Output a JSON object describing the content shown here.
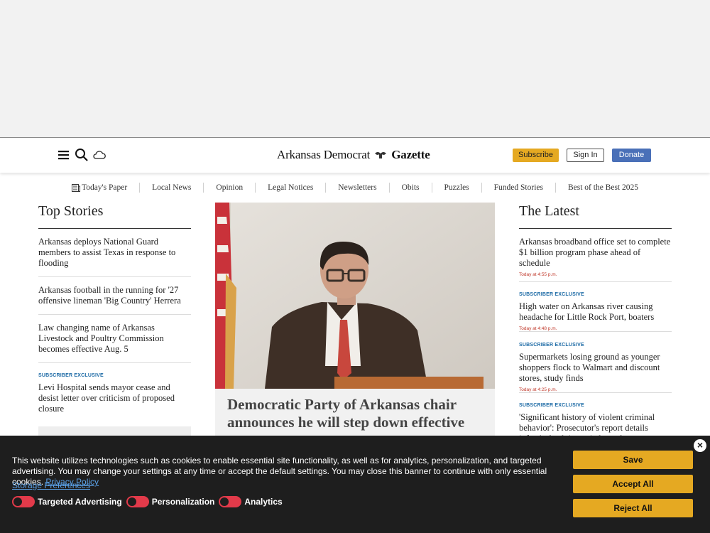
{
  "header": {
    "logo_left": "Arkansas Democrat",
    "logo_right": "Gazette",
    "subscribe_label": "Subscribe",
    "sign_in_label": "Sign In",
    "donate_label": "Donate"
  },
  "nav": {
    "items": [
      "Today's Paper",
      "Local News",
      "Opinion",
      "Legal Notices",
      "Newsletters",
      "Obits",
      "Puzzles",
      "Funded Stories",
      "Best of the Best 2025"
    ]
  },
  "top_stories": {
    "heading": "Top Stories",
    "items": [
      {
        "headline": "Arkansas deploys National Guard members to assist Texas in response to flooding"
      },
      {
        "headline": "Arkansas football in the running for '27 offensive lineman 'Big Country' Herrera"
      },
      {
        "headline": "Law changing name of Arkansas Livestock and Poultry Commission becomes effective Aug. 5"
      },
      {
        "tag": "SUBSCRIBER EXCLUSIVE",
        "headline": "Levi Hospital sends mayor cease and desist letter over criticism of proposed closure"
      }
    ]
  },
  "feature": {
    "headline": "Democratic Party of Arkansas chair announces he will step down effective"
  },
  "latest": {
    "heading": "The Latest",
    "items": [
      {
        "headline": "Arkansas broadband office set to complete $1 billion program phase ahead of schedule",
        "time": "Today at 4:55 p.m."
      },
      {
        "tag": "SUBSCRIBER EXCLUSIVE",
        "headline": "High water on Arkansas river causing headache for Little Rock Port, boaters",
        "time": "Today at 4:48 p.m."
      },
      {
        "tag": "SUBSCRIBER EXCLUSIVE",
        "headline": "Supermarkets losing ground as younger shoppers flock to Walmart and discount stores, study finds",
        "time": "Today at 4:25 p.m."
      },
      {
        "tag": "SUBSCRIBER EXCLUSIVE",
        "headline": "'Significant history of violent criminal behavior': Prosecutor's report details infant's death in capital murder case"
      }
    ]
  },
  "cookie_banner": {
    "text": "This website utilizes technologies such as cookies to enable essential site functionality, as well as for analytics, personalization, and targeted advertising. You may change your settings at any time or accept the default settings. You may close this banner to continue with only essential cookies.",
    "privacy_link": "Privacy Policy",
    "storage_link": "Storage Preferences",
    "toggles": [
      "Targeted Advertising",
      "Personalization",
      "Analytics"
    ],
    "save_label": "Save",
    "accept_label": "Accept All",
    "reject_label": "Reject All",
    "close_glyph": "×"
  },
  "colors": {
    "subscribe": "#e5a922",
    "donate": "#4a70b8",
    "exclusive_tag": "#1c6aa5",
    "timestamp": "#c0392b",
    "banner_bg": "#1e1e1e",
    "toggle_off": "#e23a4a"
  },
  "icons": [
    "menu-icon",
    "search-icon",
    "cloud-weather-icon",
    "newspaper-icon",
    "close-icon"
  ]
}
